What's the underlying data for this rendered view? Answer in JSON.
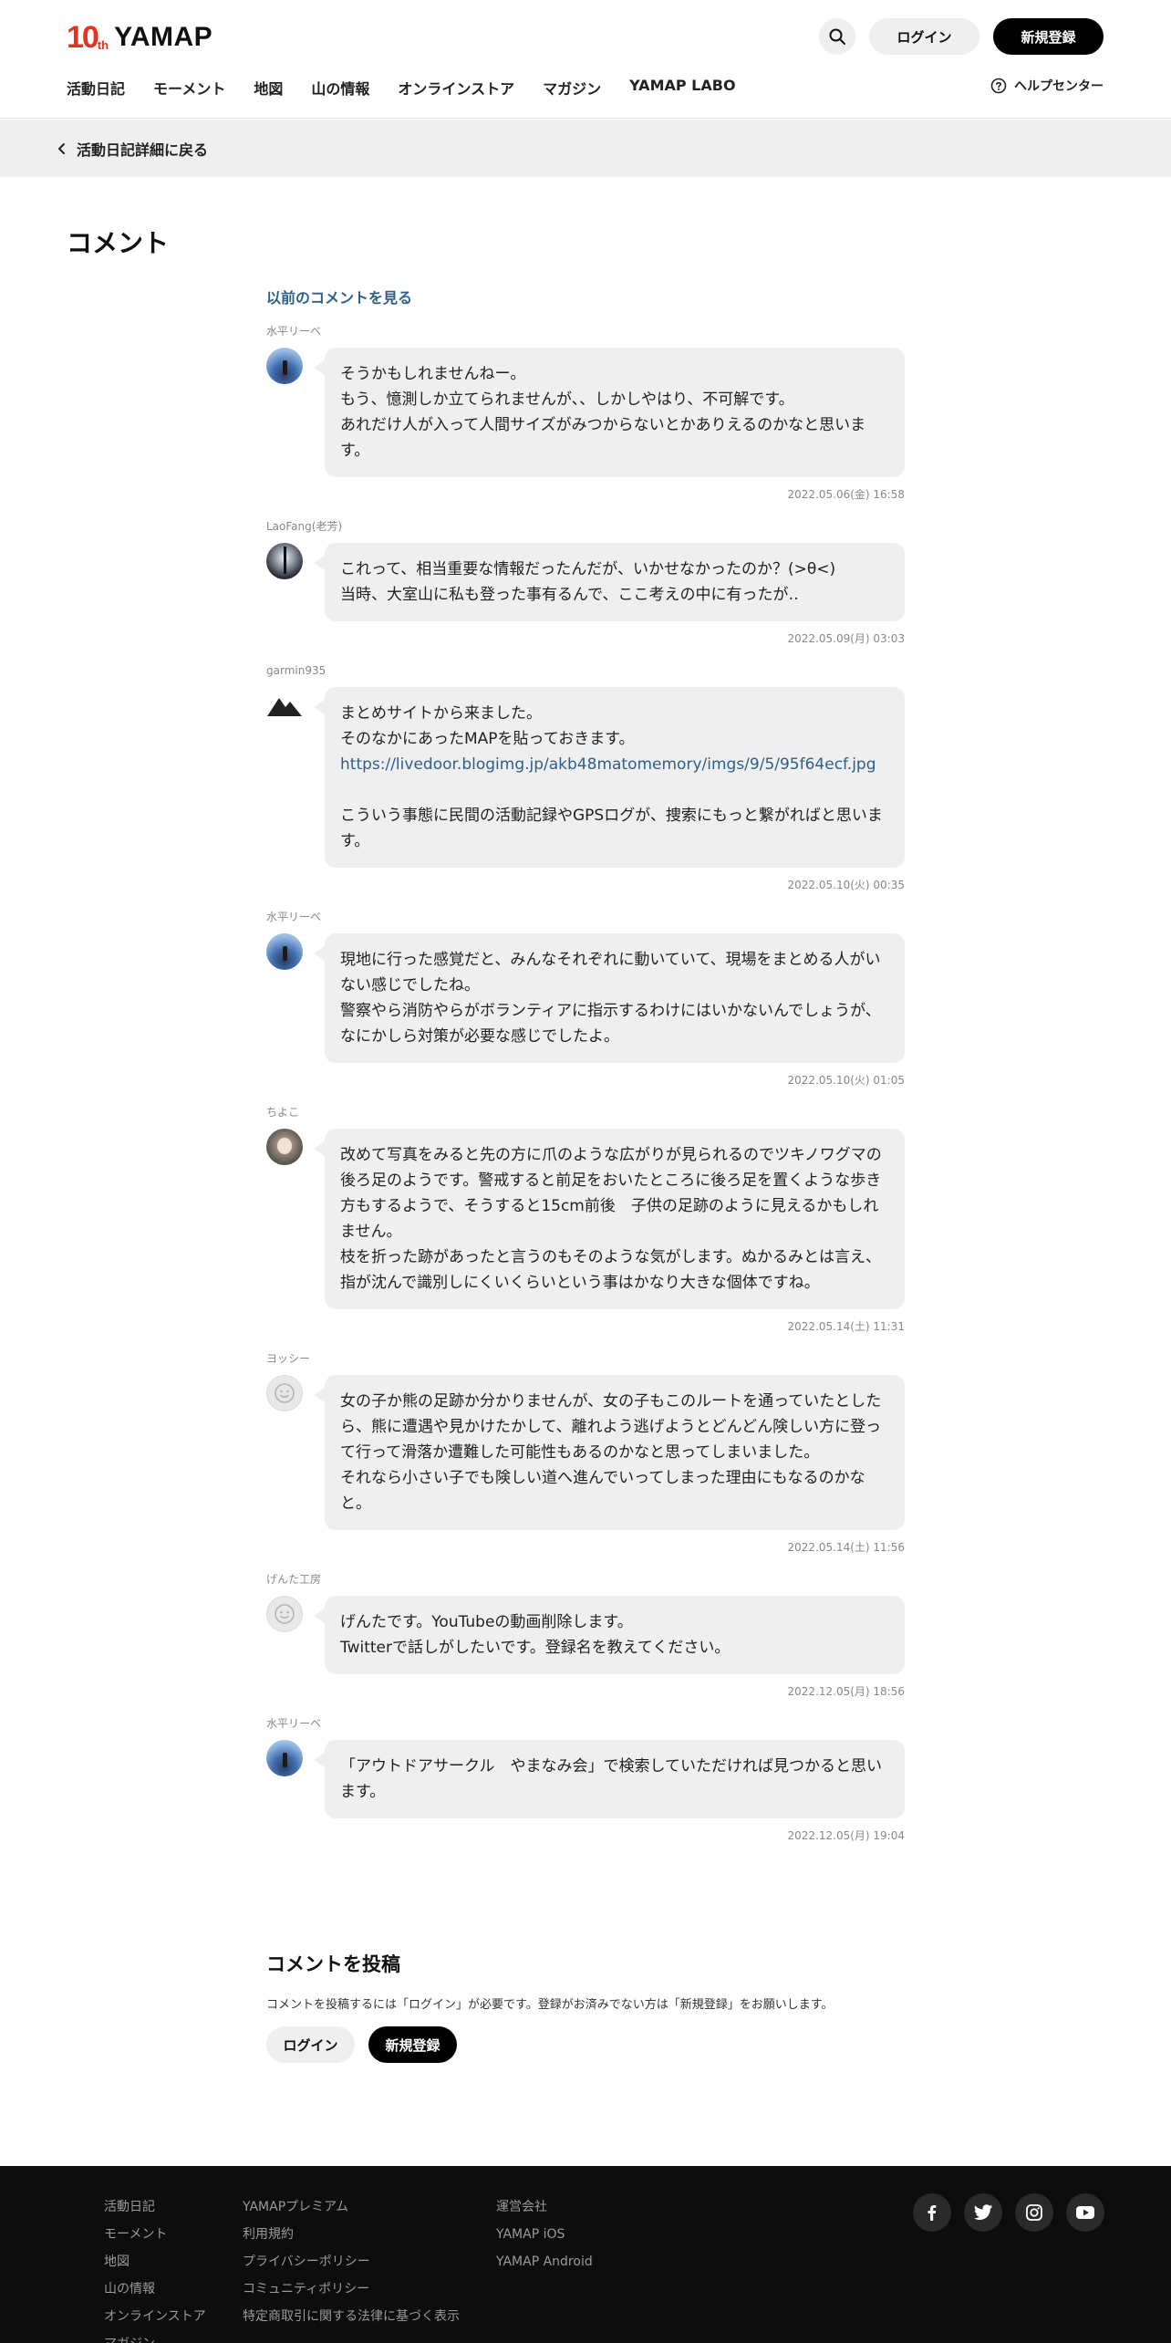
{
  "header": {
    "logo_ten": "10",
    "logo_th": "th",
    "logo_word": "YAMAP",
    "login_label": "ログイン",
    "signup_label": "新規登録",
    "help_label": "ヘルプセンター",
    "nav": [
      "活動日記",
      "モーメント",
      "地図",
      "山の情報",
      "オンラインストア",
      "マガジン",
      "YAMAP LABO"
    ]
  },
  "back": {
    "label": "活動日記詳細に戻る"
  },
  "main": {
    "title": "コメント",
    "prev_link": "以前のコメントを見る"
  },
  "comments": [
    {
      "user": "水平リーベ",
      "avatar": "sky-avatar",
      "text": "そうかもしれませんねー。\nもう、憶測しか立てられませんが、、しかしやはり、不可解です。\nあれだけ人が入って人間サイズがみつからないとかありえるのかなと思います。",
      "date": "2022.05.06(金) 16:58"
    },
    {
      "user": "LaoFang(老芳)",
      "avatar": "dark-avatar",
      "text": "これって、相当重要な情報だったんだが、いかせなかったのか？(>θ<)\n当時、大室山に私も登った事有るんで、ここ考えの中に有ったが‥",
      "date": "2022.05.09(月) 03:03"
    },
    {
      "user": "garmin935",
      "avatar": "mountain-avatar",
      "text_before": "まとめサイトから来ました。\nそのなかにあったMAPを貼っておきます。",
      "link": "https://livedoor.blogimg.jp/akb48matomemory/imgs/9/5/95f64ecf.jpg",
      "text_after": "こういう事態に民間の活動記録やGPSログが、捜索にもっと繋がればと思います。",
      "date": "2022.05.10(火) 00:35"
    },
    {
      "user": "水平リーベ",
      "avatar": "sky-avatar",
      "text": "現地に行った感覚だと、みんなそれぞれに動いていて、現場をまとめる人がいない感じでしたね。\n警察やら消防やらがボランティアに指示するわけにはいかないんでしょうが、なにかしら対策が必要な感じでしたよ。",
      "date": "2022.05.10(火) 01:05"
    },
    {
      "user": "ちよこ",
      "avatar": "child-avatar",
      "text": "改めて写真をみると先の方に爪のような広がりが見られるのでツキノワグマの後ろ足のようです。警戒すると前足をおいたところに後ろ足を置くような歩き方もするようで、そうすると15cm前後　子供の足跡のように見えるかもしれません。\n枝を折った跡があったと言うのもそのような気がします。ぬかるみとは言え、指が沈んで識別しにくいくらいという事はかなり大きな個体ですね。",
      "date": "2022.05.14(土) 11:31"
    },
    {
      "user": "ヨッシー",
      "avatar": "default-avatar",
      "text": "女の子か熊の足跡か分かりませんが、女の子もこのルートを通っていたとしたら、熊に遭遇や見かけたかして、離れよう逃げようとどんどん険しい方に登って行って滑落か遭難した可能性もあるのかなと思ってしまいました。\nそれなら小さい子でも険しい道へ進んでいってしまった理由にもなるのかなと。",
      "date": "2022.05.14(土) 11:56"
    },
    {
      "user": "げんた工房",
      "avatar": "default-avatar",
      "text": "げんたです。YouTubeの動画削除します。\nTwitterで話しがしたいです。登録名を教えてください。",
      "date": "2022.12.05(月) 18:56"
    },
    {
      "user": "水平リーベ",
      "avatar": "sky-avatar",
      "text": "「アウトドアサークル　やまなみ会」で検索していただければ見つかると思います。",
      "date": "2022.12.05(月) 19:04"
    }
  ],
  "post": {
    "title": "コメントを投稿",
    "desc": "コメントを投稿するには「ログイン」が必要です。登録がお済みでない方は「新規登録」をお願いします。",
    "login_label": "ログイン",
    "signup_label": "新規登録"
  },
  "footer": {
    "col1": [
      "活動日記",
      "モーメント",
      "地図",
      "山の情報",
      "オンラインストア",
      "マガジン"
    ],
    "col2": [
      "YAMAPプレミアム",
      "利用規約",
      "プライバシーポリシー",
      "コミュニティポリシー",
      "特定商取引に関する法律に基づく表示"
    ],
    "col3": [
      "運営会社",
      "YAMAP iOS",
      "YAMAP Android"
    ],
    "social": [
      "facebook-icon",
      "twitter-icon",
      "instagram-icon",
      "youtube-icon"
    ]
  }
}
